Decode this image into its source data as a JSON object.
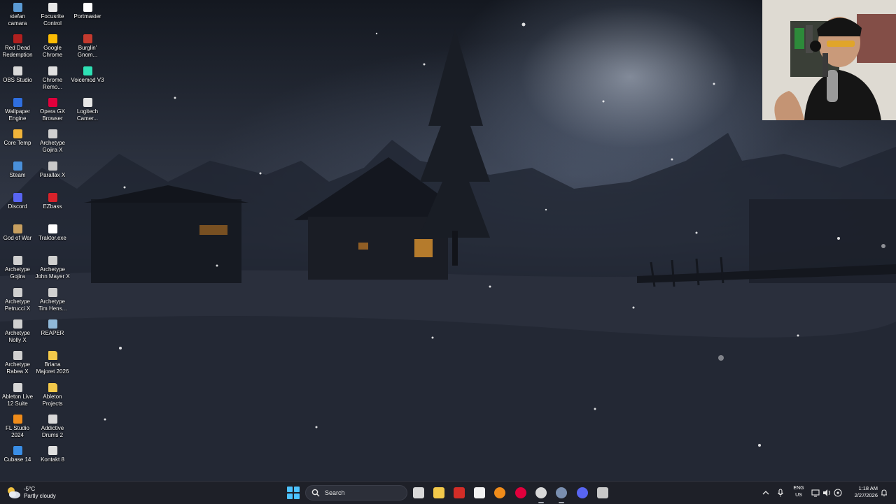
{
  "desktop": {
    "icons": [
      {
        "label": "stefan\ncamara",
        "icon": "document-icon",
        "color": "#5b9bd5"
      },
      {
        "label": "Focusrite\nControl",
        "icon": "focusrite-icon",
        "color": "#e8e8e8"
      },
      {
        "label": "Portmaster",
        "icon": "portmaster-icon",
        "color": "#ffffff"
      },
      {
        "label": "Red Dead\nRedemption",
        "icon": "rdr-icon",
        "color": "#b0201f"
      },
      {
        "label": "Google\nChrome",
        "icon": "chrome-icon",
        "color": "#fbbc04"
      },
      {
        "label": "Burglin'\nGnom...",
        "icon": "game-icon",
        "color": "#c43a2e"
      },
      {
        "label": "OBS Studio",
        "icon": "obs-icon",
        "color": "#d9d9d9"
      },
      {
        "label": "Chrome\nRemo...",
        "icon": "chrome-remote-icon",
        "color": "#e0e0e0"
      },
      {
        "label": "Voicemod V3",
        "icon": "voicemod-icon",
        "color": "#2fe1b5"
      },
      {
        "label": "Wallpaper\nEngine",
        "icon": "wallpaper-engine-icon",
        "color": "#2f6fe0"
      },
      {
        "label": "Opera GX\nBrowser",
        "icon": "opera-gx-icon",
        "color": "#e1003c"
      },
      {
        "label": "Logitech\nCamer...",
        "icon": "logitech-icon",
        "color": "#e6e6e6"
      },
      {
        "label": "Core Temp",
        "icon": "core-temp-icon",
        "color": "#f1b43a"
      },
      {
        "label": "Archetype\nGojira X",
        "icon": "archetype-icon",
        "color": "#d0d0d0"
      },
      {
        "label": "Steam",
        "icon": "steam-icon",
        "color": "#4a90d9"
      },
      {
        "label": "Parallax X",
        "icon": "parallax-icon",
        "color": "#c9c9c9"
      },
      {
        "label": "Discord",
        "icon": "discord-icon",
        "color": "#5865f2"
      },
      {
        "label": "EZbass",
        "icon": "ezbass-icon",
        "color": "#d8222a"
      },
      {
        "label": "God of War",
        "icon": "god-of-war-icon",
        "color": "#c8a060"
      },
      {
        "label": "Traktor.exe",
        "icon": "traktor-icon",
        "color": "#ffffff"
      },
      {
        "label": "Archetype\nGojira",
        "icon": "archetype-icon",
        "color": "#d0d0d0"
      },
      {
        "label": "Archetype\nJohn Mayer X",
        "icon": "archetype-icon",
        "color": "#d0d0d0"
      },
      {
        "label": "Archetype\nPetrucci X",
        "icon": "archetype-icon",
        "color": "#d0d0d0"
      },
      {
        "label": "Archetype\nTim Hens...",
        "icon": "archetype-icon",
        "color": "#d0d0d0"
      },
      {
        "label": "Archetype\nNolly X",
        "icon": "archetype-icon",
        "color": "#d0d0d0"
      },
      {
        "label": "REAPER",
        "icon": "reaper-icon",
        "color": "#8fb8d8"
      },
      {
        "label": "Archetype\nRabea X",
        "icon": "archetype-icon",
        "color": "#d0d0d0"
      },
      {
        "label": "Briana\nMajoret 2026",
        "icon": "folder-icon",
        "color": "#f3c94a"
      },
      {
        "label": "Ableton Live\n12 Suite",
        "icon": "ableton-icon",
        "color": "#d6d6d6"
      },
      {
        "label": "Ableton\nProjects",
        "icon": "folder-icon",
        "color": "#f3c94a"
      },
      {
        "label": "FL Studio\n2024",
        "icon": "fl-studio-icon",
        "color": "#f08c1a"
      },
      {
        "label": "Addictive\nDrums 2",
        "icon": "addictive-drums-icon",
        "color": "#d8d8d8"
      },
      {
        "label": "Cubase 14",
        "icon": "cubase-icon",
        "color": "#3a8ee6"
      },
      {
        "label": "Kontakt 8",
        "icon": "kontakt-icon",
        "color": "#e0e0e0"
      }
    ]
  },
  "taskbar": {
    "weather": {
      "temp": "-5°C",
      "condition": "Partly cloudy"
    },
    "search_placeholder": "Search",
    "apps": [
      {
        "icon": "task-view-icon",
        "color": "#d9d9d9",
        "active": false
      },
      {
        "icon": "file-explorer-icon",
        "color": "#f3c94a",
        "active": false
      },
      {
        "icon": "lastpass-icon",
        "color": "#d32d27",
        "active": false
      },
      {
        "icon": "microsoft-store-icon",
        "color": "#f2f2f2",
        "active": false
      },
      {
        "icon": "firefox-icon",
        "color": "#f08c1a",
        "active": false
      },
      {
        "icon": "opera-gx-icon",
        "color": "#e1003c",
        "active": false
      },
      {
        "icon": "obs-icon",
        "color": "#d9d9d9",
        "active": true
      },
      {
        "icon": "steam-icon",
        "color": "#7a8fb0",
        "active": true
      },
      {
        "icon": "discord-icon",
        "color": "#5865f2",
        "active": false
      },
      {
        "icon": "voicemod-icon",
        "color": "#c8c8c8",
        "active": false
      }
    ],
    "tray": {
      "language_line1": "ENG",
      "language_line2": "US",
      "time": "1:18 AM",
      "date": "2/27/2026"
    }
  }
}
